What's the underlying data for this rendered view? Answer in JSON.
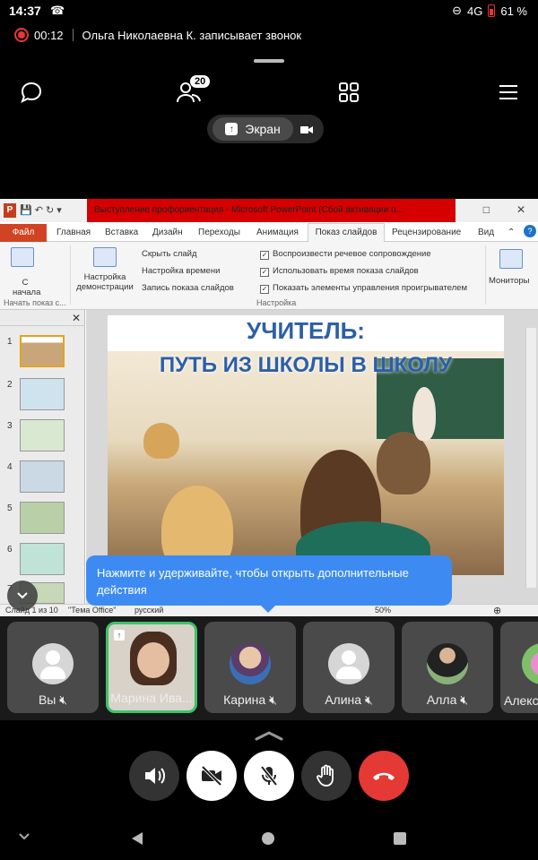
{
  "status_bar": {
    "time": "14:37",
    "network": "4G",
    "battery": "61 %"
  },
  "recording": {
    "duration": "00:12",
    "text": "Ольга Николаевна К. записывает звонок"
  },
  "top_nav": {
    "participants_count": "20"
  },
  "screen_share": {
    "label": "Экран"
  },
  "ppt": {
    "window_title": "Выступление профориентация - Microsoft PowerPoint (Сбой активации п...",
    "tabs": [
      "Файл",
      "Главная",
      "Вставка",
      "Дизайн",
      "Переходы",
      "Анимация",
      "Показ слайдов",
      "Рецензирование",
      "Вид"
    ],
    "ribbon": {
      "from_start": "С начала",
      "setup": "Настройка демонстрации",
      "hide_slide": "Скрыть слайд",
      "rehearse": "Настройка времени",
      "record": "Запись показа слайдов",
      "play_narration": "Воспроизвести речевое сопровождение",
      "use_timings": "Использовать время показа слайдов",
      "show_controls": "Показать элементы управления проигрывателем",
      "monitors": "Мониторы",
      "group_start": "Начать показ с...",
      "group_setup": "Настройка"
    },
    "slide_numbers": [
      "1",
      "2",
      "3",
      "4",
      "5",
      "6",
      "7"
    ],
    "slide": {
      "title1": "УЧИТЕЛЬ:",
      "title2": "ПУТЬ ИЗ ШКОЛЫ В ШКОЛУ"
    },
    "status": {
      "slide_info": "Слайд 1 из 10",
      "theme": "\"Тема Office\"",
      "language": "русский",
      "zoom": "50%"
    }
  },
  "tooltip": {
    "text": "Нажмите и удерживайте, чтобы открыть дополнительные действия"
  },
  "participants": [
    {
      "name": "Вы"
    },
    {
      "name": "Марина Ива..."
    },
    {
      "name": "Карина"
    },
    {
      "name": "Алина"
    },
    {
      "name": "Алла"
    },
    {
      "name": "Алекс"
    }
  ]
}
